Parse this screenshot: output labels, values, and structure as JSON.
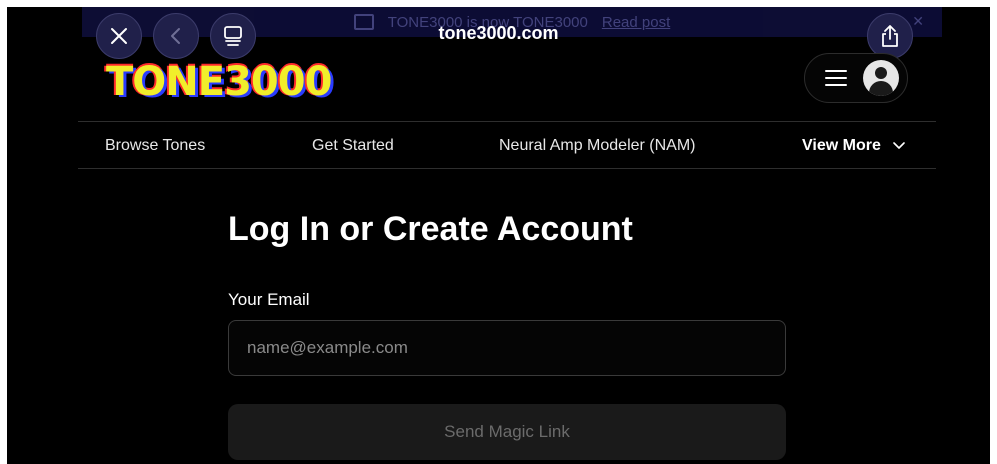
{
  "browser": {
    "url": "tone3000.com",
    "close_icon": "close-icon",
    "back_icon": "chevron-left-icon",
    "tabs_icon": "tabs-icon",
    "share_icon": "share-icon"
  },
  "banner": {
    "text": "TONE3000 is now TONE3000",
    "link": "Read post",
    "close": "✕"
  },
  "logo": {
    "text": "TONE3000"
  },
  "header_menu": {
    "menu_icon": "hamburger-icon",
    "avatar_icon": "user-avatar-icon"
  },
  "nav": {
    "items": [
      "Browse Tones",
      "Get Started",
      "Neural Amp Modeler (NAM)"
    ],
    "more_label": "View More"
  },
  "form": {
    "title": "Log In or Create Account",
    "email_label": "Your Email",
    "email_placeholder": "name@example.com",
    "email_value": "",
    "submit_label": "Send Magic Link"
  },
  "colors": {
    "background": "#000000",
    "chrome_button": "#20204a",
    "logo_yellow": "#f1ee2b",
    "logo_red": "#ff2a2a",
    "logo_blue": "#2a3cff",
    "disabled_button": "#1a1a1a"
  }
}
